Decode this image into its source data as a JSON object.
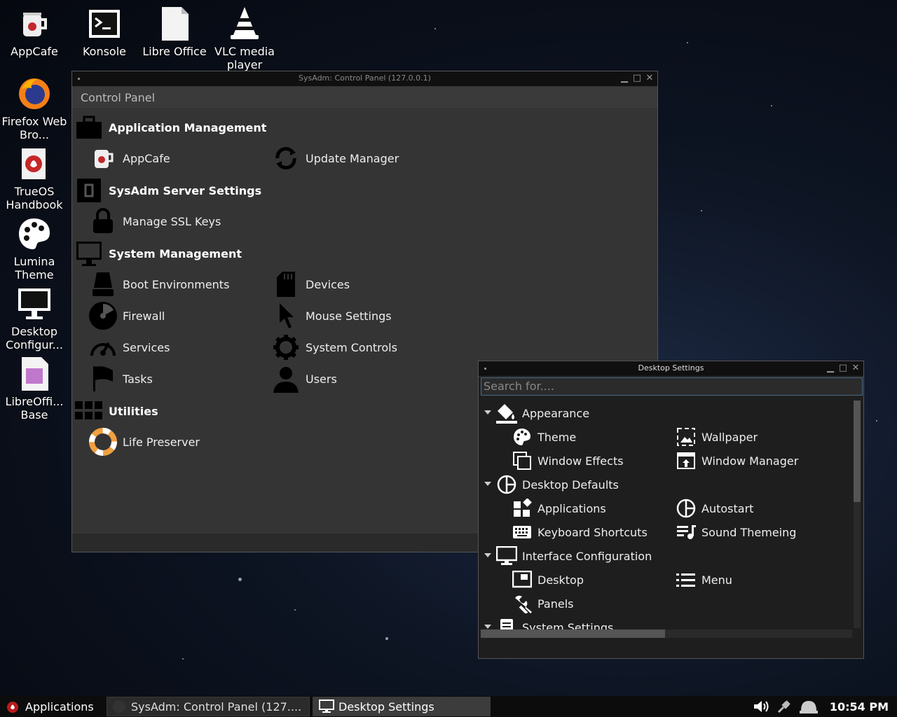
{
  "desktop": {
    "icons": [
      {
        "label": "AppCafe",
        "icon": "coffee-cup-icon"
      },
      {
        "label": "Konsole",
        "icon": "terminal-icon"
      },
      {
        "label": "Libre Office",
        "icon": "document-icon"
      },
      {
        "label": "VLC media player",
        "icon": "traffic-cone-icon"
      },
      {
        "label": "Firefox Web Bro...",
        "icon": "firefox-icon"
      },
      {
        "label": "TrueOS Handbook",
        "icon": "book-icon"
      },
      {
        "label": "Lumina Theme",
        "icon": "palette-icon"
      },
      {
        "label": "Desktop Configur...",
        "icon": "monitor-icon"
      },
      {
        "label": "LibreOffi... Base",
        "icon": "database-document-icon"
      }
    ]
  },
  "control_panel": {
    "title": "SysAdm: Control Panel (127.0.0.1)",
    "header": "Control Panel",
    "categories": {
      "app_mgmt": "Application Management",
      "server": "SysAdm Server Settings",
      "system": "System Management",
      "utilities": "Utilities"
    },
    "items": {
      "appcafe": "AppCafe",
      "update_manager": "Update Manager",
      "ssl_keys": "Manage SSL Keys",
      "boot_env": "Boot Environments",
      "devices": "Devices",
      "firewall": "Firewall",
      "mouse": "Mouse Settings",
      "services": "Services",
      "system_controls": "System Controls",
      "tasks": "Tasks",
      "users": "Users",
      "life_preserver": "Life Preserver"
    }
  },
  "desktop_settings": {
    "title": "Desktop Settings",
    "search_placeholder": "Search for....",
    "groups": {
      "appearance": "Appearance",
      "defaults": "Desktop Defaults",
      "interface": "Interface Configuration",
      "system": "System Settings"
    },
    "items": {
      "theme": "Theme",
      "wallpaper": "Wallpaper",
      "window_effects": "Window Effects",
      "window_manager": "Window Manager",
      "applications": "Applications",
      "autostart": "Autostart",
      "keyboard": "Keyboard Shortcuts",
      "sound": "Sound Themeing",
      "desktop": "Desktop",
      "menu": "Menu",
      "panels": "Panels"
    }
  },
  "taskbar": {
    "start_label": "Applications",
    "tasks": [
      "SysAdm: Control Panel (127....",
      "Desktop Settings"
    ],
    "clock": "10:54 PM"
  }
}
